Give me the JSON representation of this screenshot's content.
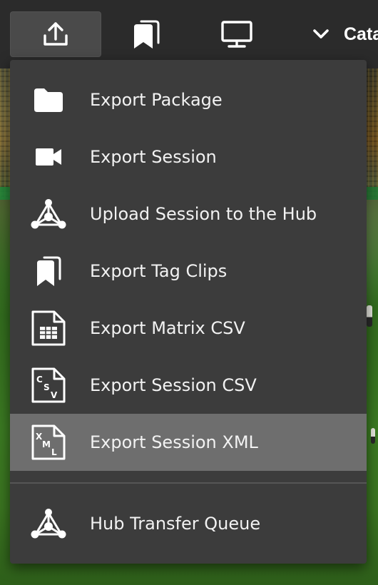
{
  "toolbar": {
    "buttons": [
      {
        "icon": "export-icon",
        "active": true
      },
      {
        "icon": "bookmarks-icon",
        "active": false
      },
      {
        "icon": "monitor-icon",
        "active": false
      },
      {
        "icon": "chevron-down-icon",
        "active": false
      }
    ],
    "truncated_label": "Cata"
  },
  "export_menu": {
    "items": [
      {
        "label": "Export Package",
        "icon": "folder-icon"
      },
      {
        "label": "Export Session",
        "icon": "video-camera-icon"
      },
      {
        "label": "Upload Session to the Hub",
        "icon": "hub-icon"
      },
      {
        "label": "Export Tag Clips",
        "icon": "bookmarks-icon"
      },
      {
        "label": "Export Matrix CSV",
        "icon": "matrix-csv-file-icon"
      },
      {
        "label": "Export Session CSV",
        "icon": "csv-file-icon"
      },
      {
        "label": "Export Session XML",
        "icon": "xml-file-icon",
        "highlighted": true
      }
    ],
    "footer_item": {
      "label": "Hub Transfer Queue",
      "icon": "hub-icon"
    }
  },
  "colors": {
    "toolbar_bg": "#2b2b2b",
    "active_button_bg": "#4a4a4a",
    "menu_bg": "#3c3c3c",
    "highlight_bg": "#6e6e6e",
    "text": "#f2f2f2"
  }
}
